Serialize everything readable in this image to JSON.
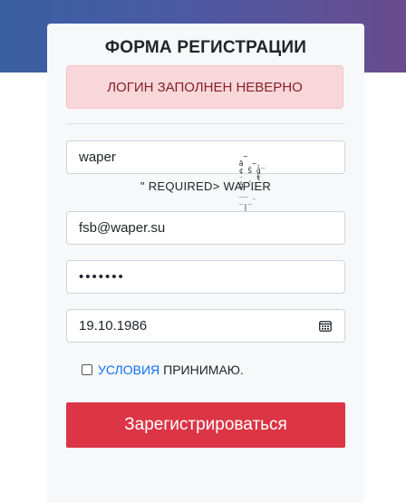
{
  "form": {
    "title": "ФОРМА РЕГИСТРАЦИИ",
    "error_message": "ЛОГИН ЗАПОЛНЕН НЕВЕРНО",
    "login_value": "waper",
    "login_hint": "\" REQUIRED> WAPIER",
    "email_value": "fsb@waper.su",
    "password_value": "•••••••",
    "date_value": "19.10.1986",
    "terms_link": "УСЛОВИЯ",
    "terms_text": "ПРИНИМАЮ.",
    "terms_checked": false,
    "submit_label": "Зарегистрироваться"
  },
  "colors": {
    "banner_start": "#3a5fa3",
    "banner_end": "#6a4b8e",
    "alert_bg": "#f8d7da",
    "alert_text": "#842029",
    "link": "#0d6efd",
    "submit_bg": "#dc3545"
  },
  "icons": {
    "date": "calendar-icon",
    "terms": "checkbox"
  }
}
